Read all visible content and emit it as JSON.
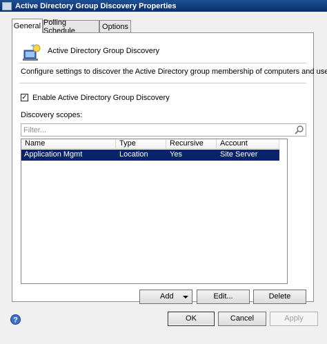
{
  "window": {
    "title": "Active Directory Group Discovery Properties"
  },
  "tabs": [
    {
      "label": "General"
    },
    {
      "label": "Polling Schedule"
    },
    {
      "label": "Options"
    }
  ],
  "header": {
    "title": "Active Directory Group Discovery"
  },
  "description": "Configure settings to discover the Active Directory group membership of computers and users.",
  "enable_checkbox": {
    "label": "Enable Active Directory Group Discovery",
    "checked": true
  },
  "scopes": {
    "label": "Discovery scopes:",
    "filter_placeholder": "Filter...",
    "columns": [
      "Name",
      "Type",
      "Recursive",
      "Account"
    ],
    "rows": [
      {
        "name": "Application Mgmt",
        "type": "Location",
        "recursive": "Yes",
        "account": "Site Server",
        "selected": true
      }
    ]
  },
  "scope_buttons": {
    "add": "Add",
    "edit": "Edit...",
    "delete": "Delete"
  },
  "dialog_buttons": {
    "ok": "OK",
    "cancel": "Cancel",
    "apply": "Apply"
  },
  "colors": {
    "selection": "#0a246a",
    "titlebar": "#0a2f6d"
  },
  "icons": [
    "app-icon",
    "ad-discovery-icon",
    "search-icon",
    "dropdown-arrow-icon",
    "help-icon"
  ]
}
